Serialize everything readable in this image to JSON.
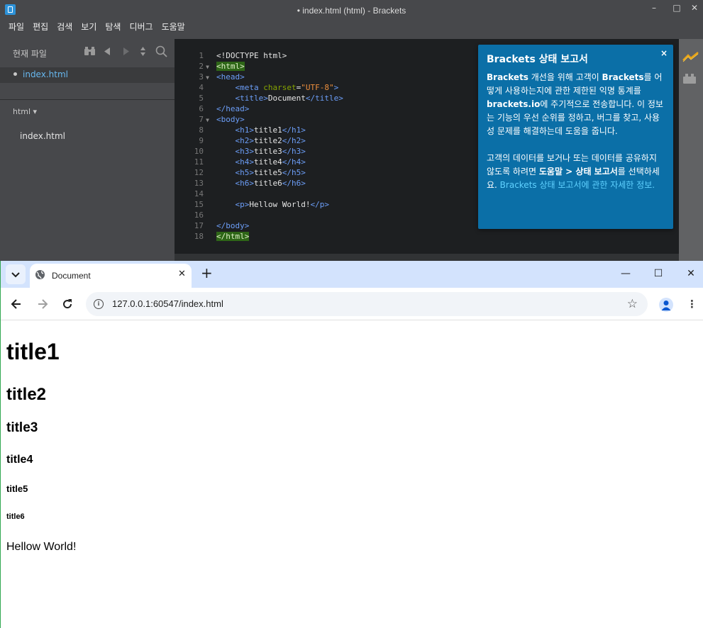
{
  "brackets": {
    "title": "• index.html (html) - Brackets",
    "menu": [
      "파일",
      "편집",
      "검색",
      "보기",
      "탐색",
      "디버그",
      "도움말"
    ],
    "sidebar": {
      "working_files_header": "현재 파일",
      "working_file": "index.html",
      "project_name": "html ▾",
      "project_file": "index.html"
    },
    "code_lines": [
      {
        "num": "1",
        "fold": ""
      },
      {
        "num": "2",
        "fold": "▼"
      },
      {
        "num": "3",
        "fold": "▼"
      },
      {
        "num": "4",
        "fold": ""
      },
      {
        "num": "5",
        "fold": ""
      },
      {
        "num": "6",
        "fold": ""
      },
      {
        "num": "7",
        "fold": "▼"
      },
      {
        "num": "8",
        "fold": ""
      },
      {
        "num": "9",
        "fold": ""
      },
      {
        "num": "10",
        "fold": ""
      },
      {
        "num": "11",
        "fold": ""
      },
      {
        "num": "12",
        "fold": ""
      },
      {
        "num": "13",
        "fold": ""
      },
      {
        "num": "14",
        "fold": ""
      },
      {
        "num": "15",
        "fold": ""
      },
      {
        "num": "16",
        "fold": ""
      },
      {
        "num": "17",
        "fold": ""
      },
      {
        "num": "18",
        "fold": ""
      }
    ],
    "code": {
      "l1": "<!DOCTYPE html>",
      "l2": "<html>",
      "l3": "<head>",
      "l4_open": "<meta ",
      "l4_attr": "charset",
      "l4_eq": "=",
      "l4_val": "\"UTF-8\"",
      "l4_close": ">",
      "l5_open": "<title>",
      "l5_text": "Document",
      "l5_close": "</title>",
      "l6": "</head>",
      "l7": "<body>",
      "h1_open": "<h1>",
      "h1_text": "title1",
      "h1_close": "</h1>",
      "h2_open": "<h2>",
      "h2_text": "title2",
      "h2_close": "</h2>",
      "h3_open": "<h3>",
      "h3_text": "title3",
      "h3_close": "</h3>",
      "h4_open": "<h4>",
      "h4_text": "title4",
      "h4_close": "</h4>",
      "h5_open": "<h5>",
      "h5_text": "title5",
      "h5_close": "</h5>",
      "h6_open": "<h6>",
      "h6_text": "title6",
      "h6_close": "</h6>",
      "p_open": "<p>",
      "p_text": "Hellow World!",
      "p_close": "</p>",
      "l17": "</body>",
      "l18": "</html>"
    },
    "health_report": {
      "title": "Brackets 상태 보고서",
      "close": "×",
      "p1_a": "Brackets",
      "p1_b": " 개선을 위해 고객이 ",
      "p1_c": "Brackets",
      "p1_d": "를 어떻게 사용하는지에 관한 제한된 익명 통계를 ",
      "p1_e": "brackets.io",
      "p1_f": "에 주기적으로 전송합니다. 이 정보는 기능의 우선 순위를 정하고, 버그를 찾고, 사용성 문제를 해결하는데 도움을 줍니다.",
      "p2_a": "고객의 데이터를 보거나 또는 데이터를 공유하지 않도록 하려면 ",
      "p2_b": "도움말 > 상태 보고서",
      "p2_c": "를 선택하세요. ",
      "link": "Brackets 상태 보고서에 관한 자세한 정보."
    }
  },
  "chrome": {
    "tab_title": "Document",
    "tab_close": "✕",
    "new_tab": "+",
    "url": "127.0.0.1:60547/index.html",
    "page": {
      "h1": "title1",
      "h2": "title2",
      "h3": "title3",
      "h4": "title4",
      "h5": "title5",
      "h6": "title6",
      "p": "Hellow World!"
    }
  }
}
